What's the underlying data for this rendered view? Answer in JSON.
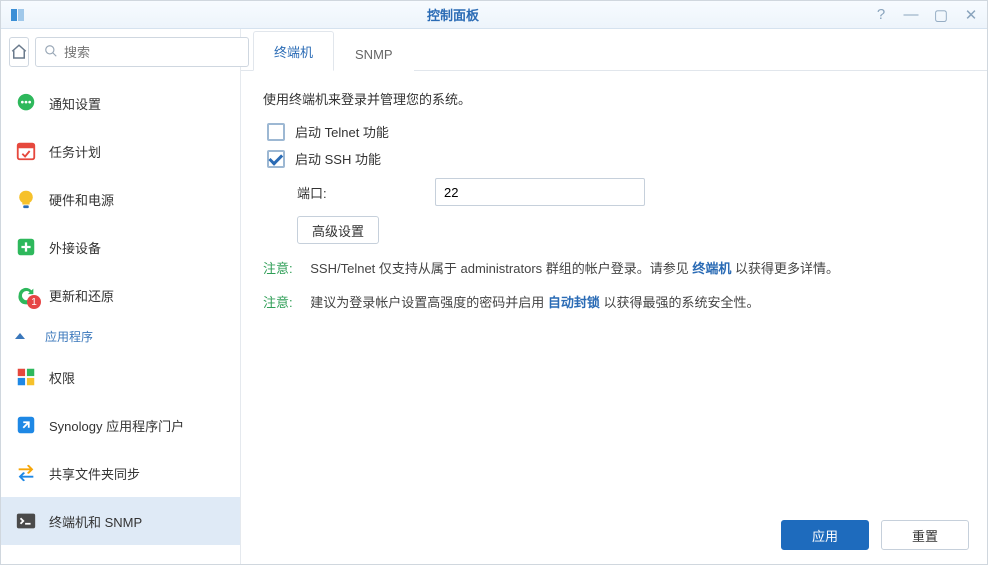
{
  "window": {
    "title": "控制面板"
  },
  "search": {
    "placeholder": "搜索"
  },
  "sidebar": {
    "section_label": "应用程序",
    "items": [
      {
        "label": "通知设置",
        "icon": "speech",
        "color": "#2eb85c"
      },
      {
        "label": "任务计划",
        "icon": "calendar",
        "color": "#e6483d"
      },
      {
        "label": "硬件和电源",
        "icon": "bulb",
        "color": "#f6c12b"
      },
      {
        "label": "外接设备",
        "icon": "external",
        "color": "#2eb85c"
      },
      {
        "label": "更新和还原",
        "icon": "refresh",
        "color": "#2eb85c",
        "badge": "1"
      }
    ],
    "app_items": [
      {
        "label": "权限",
        "icon": "blocks"
      },
      {
        "label": "Synology 应用程序门户",
        "icon": "portal",
        "color": "#1e88e5"
      },
      {
        "label": "共享文件夹同步",
        "icon": "sync",
        "color": "#f6a609"
      },
      {
        "label": "终端机和 SNMP",
        "icon": "terminal",
        "color": "#555",
        "active": true
      }
    ]
  },
  "tabs": [
    {
      "label": "终端机",
      "active": true
    },
    {
      "label": "SNMP",
      "active": false
    }
  ],
  "content": {
    "description": "使用终端机来登录并管理您的系统。",
    "telnet_checkbox_label": "启动 Telnet 功能",
    "telnet_checked": false,
    "ssh_checkbox_label": "启动 SSH 功能",
    "ssh_checked": true,
    "port_label": "端口:",
    "port_value": "22",
    "advanced_button": "高级设置",
    "note1_label": "注意:",
    "note1_before": "SSH/Telnet 仅支持从属于 administrators 群组的帐户登录。请参见 ",
    "note1_link": "终端机",
    "note1_after": " 以获得更多详情。",
    "note2_label": "注意:",
    "note2_before": "建议为登录帐户设置高强度的密码并启用 ",
    "note2_link": "自动封锁",
    "note2_after": " 以获得最强的系统安全性。"
  },
  "footer": {
    "apply": "应用",
    "reset": "重置"
  }
}
